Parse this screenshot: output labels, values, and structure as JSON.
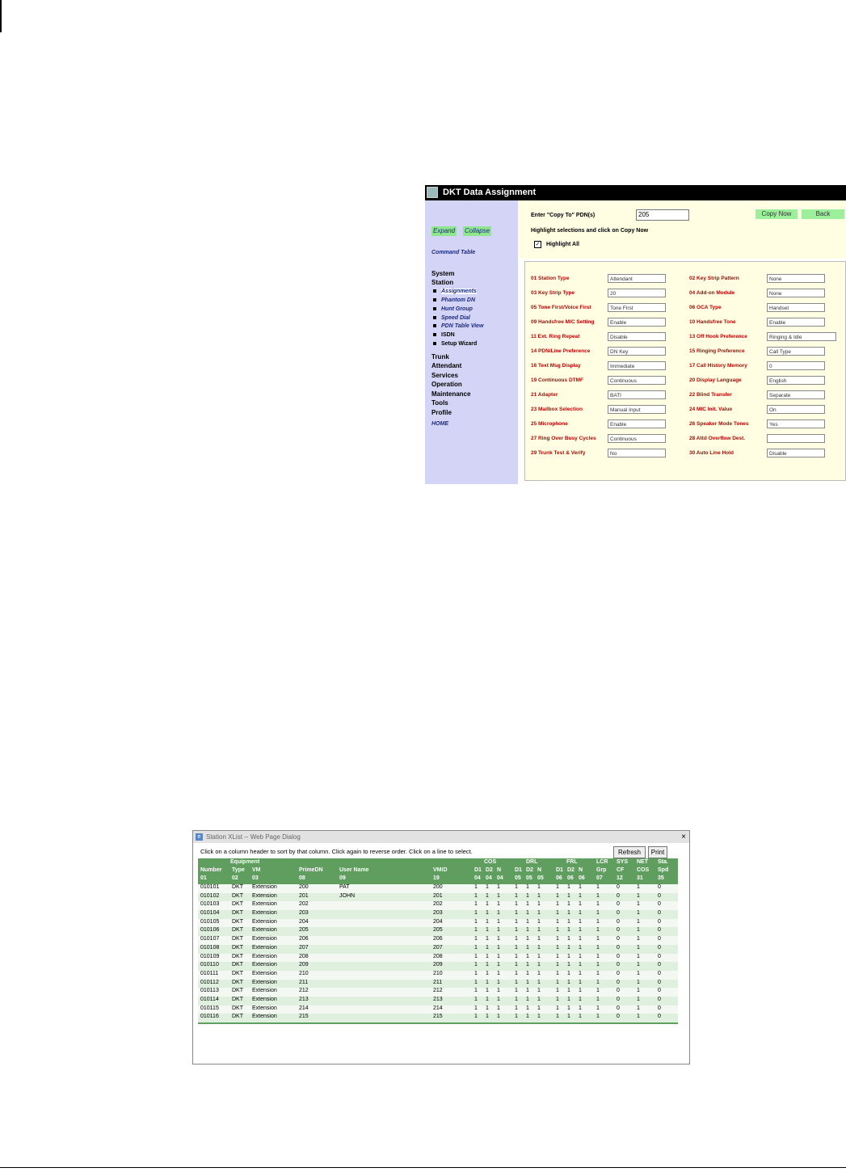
{
  "dkt": {
    "title": "DKT Data Assignment",
    "sidebar": {
      "expand": "Expand",
      "collapse": "Collapse",
      "command_table": "Command Table",
      "categories": [
        "System",
        "Station",
        "Trunk",
        "Attendant",
        "Services",
        "Operation",
        "Maintenance",
        "Tools",
        "Profile"
      ],
      "station_items": [
        "Assignments",
        "Phantom DN",
        "Hunt Group",
        "Speed Dial",
        "PDN Table View",
        "ISDN",
        "Setup Wizard"
      ],
      "home": "HOME"
    },
    "copy_to_label": "Enter \"Copy To\" PDN(s)",
    "copy_to_value": "205",
    "copy_now": "Copy Now",
    "back": "Back",
    "instruction": "Highlight selections and click on Copy Now",
    "highlight_all": "Highlight All",
    "highlight_checked": true,
    "fields": [
      {
        "label": "01 Station Type",
        "value": "Attendant"
      },
      {
        "label": "02 Key Strip Pattern",
        "value": "None"
      },
      {
        "label": "03 Key Strip Type",
        "value": "20"
      },
      {
        "label": "04 Add-on Module",
        "value": "None"
      },
      {
        "label": "05 Tone First/Voice First",
        "value": "Tone First"
      },
      {
        "label": "06 OCA Type",
        "value": "Handset"
      },
      {
        "label": "09 Handsfree MIC Setting",
        "value": "Enable"
      },
      {
        "label": "10 Handsfree Tone",
        "value": "Enable"
      },
      {
        "label": "11 Ext. Ring Repeat",
        "value": "Disable"
      },
      {
        "label": "13 Off Hook Preference",
        "value": "Ringing & Idle"
      },
      {
        "label": "14 PDN/Line Preference",
        "value": "DN Key"
      },
      {
        "label": "15 Ringing Preference",
        "value": "Call Type"
      },
      {
        "label": "16 Text Msg Display",
        "value": "Immediate"
      },
      {
        "label": "17 Call History Memory",
        "value": "0"
      },
      {
        "label": "19 Continuous DTMF",
        "value": "Continuous"
      },
      {
        "label": "20 Display Language",
        "value": "English"
      },
      {
        "label": "21 Adapter",
        "value": "BATI"
      },
      {
        "label": "22 Blind Transfer",
        "value": "Separate"
      },
      {
        "label": "23 Mailbox Selection",
        "value": "Manual Input"
      },
      {
        "label": "24 MIC Init. Value",
        "value": "On"
      },
      {
        "label": "25 Microphone",
        "value": "Enable"
      },
      {
        "label": "26 Speaker Mode Tones",
        "value": "Yes"
      },
      {
        "label": "27 Ring Over Busy Cycles",
        "value": "Continuous"
      },
      {
        "label": "28 Attd Overflow Dest.",
        "value": ""
      },
      {
        "label": "29 Trunk Test & Verify",
        "value": "No"
      },
      {
        "label": "30 Auto Line Hold",
        "value": "Disable"
      }
    ]
  },
  "xlist": {
    "title": "Station XList -- Web Page Dialog",
    "close": "×",
    "instruction": "Click on a column header to sort by that column. Click again to reverse order. Click on a line to select.",
    "refresh": "Refresh",
    "print": "Print",
    "header_groups": [
      "Equipment",
      "COS",
      "DRL",
      "FRL",
      "LCR",
      "SYS",
      "NET",
      "Sta."
    ],
    "header_names": [
      "Number",
      "Type",
      "VM",
      "PrimeDN",
      "User Name",
      "VMID",
      "D1",
      "D2",
      "N",
      "D1",
      "D2",
      "N",
      "D1",
      "D2",
      "N",
      "Grp",
      "CF",
      "COS",
      "Spd"
    ],
    "header_codes": [
      "01",
      "02",
      "03",
      "08",
      "09",
      "19",
      "04",
      "04",
      "04",
      "05",
      "05",
      "05",
      "06",
      "06",
      "06",
      "07",
      "12",
      "31",
      "35"
    ],
    "rows": [
      [
        "010101",
        "DKT",
        "Extension",
        "200",
        "PAT",
        "200",
        "1",
        "1",
        "1",
        "1",
        "1",
        "1",
        "1",
        "1",
        "1",
        "1",
        "0",
        "1",
        "0"
      ],
      [
        "010102",
        "DKT",
        "Extension",
        "201",
        "JOHN",
        "201",
        "1",
        "1",
        "1",
        "1",
        "1",
        "1",
        "1",
        "1",
        "1",
        "1",
        "0",
        "1",
        "0"
      ],
      [
        "010103",
        "DKT",
        "Extension",
        "202",
        "",
        "202",
        "1",
        "1",
        "1",
        "1",
        "1",
        "1",
        "1",
        "1",
        "1",
        "1",
        "0",
        "1",
        "0"
      ],
      [
        "010104",
        "DKT",
        "Extension",
        "203",
        "",
        "203",
        "1",
        "1",
        "1",
        "1",
        "1",
        "1",
        "1",
        "1",
        "1",
        "1",
        "0",
        "1",
        "0"
      ],
      [
        "010105",
        "DKT",
        "Extension",
        "204",
        "",
        "204",
        "1",
        "1",
        "1",
        "1",
        "1",
        "1",
        "1",
        "1",
        "1",
        "1",
        "0",
        "1",
        "0"
      ],
      [
        "010106",
        "DKT",
        "Extension",
        "205",
        "",
        "205",
        "1",
        "1",
        "1",
        "1",
        "1",
        "1",
        "1",
        "1",
        "1",
        "1",
        "0",
        "1",
        "0"
      ],
      [
        "010107",
        "DKT",
        "Extension",
        "206",
        "",
        "206",
        "1",
        "1",
        "1",
        "1",
        "1",
        "1",
        "1",
        "1",
        "1",
        "1",
        "0",
        "1",
        "0"
      ],
      [
        "010108",
        "DKT",
        "Extension",
        "207",
        "",
        "207",
        "1",
        "1",
        "1",
        "1",
        "1",
        "1",
        "1",
        "1",
        "1",
        "1",
        "0",
        "1",
        "0"
      ],
      [
        "010109",
        "DKT",
        "Extension",
        "208",
        "",
        "208",
        "1",
        "1",
        "1",
        "1",
        "1",
        "1",
        "1",
        "1",
        "1",
        "1",
        "0",
        "1",
        "0"
      ],
      [
        "010110",
        "DKT",
        "Extension",
        "209",
        "",
        "209",
        "1",
        "1",
        "1",
        "1",
        "1",
        "1",
        "1",
        "1",
        "1",
        "1",
        "0",
        "1",
        "0"
      ],
      [
        "010111",
        "DKT",
        "Extension",
        "210",
        "",
        "210",
        "1",
        "1",
        "1",
        "1",
        "1",
        "1",
        "1",
        "1",
        "1",
        "1",
        "0",
        "1",
        "0"
      ],
      [
        "010112",
        "DKT",
        "Extension",
        "211",
        "",
        "211",
        "1",
        "1",
        "1",
        "1",
        "1",
        "1",
        "1",
        "1",
        "1",
        "1",
        "0",
        "1",
        "0"
      ],
      [
        "010113",
        "DKT",
        "Extension",
        "212",
        "",
        "212",
        "1",
        "1",
        "1",
        "1",
        "1",
        "1",
        "1",
        "1",
        "1",
        "1",
        "0",
        "1",
        "0"
      ],
      [
        "010114",
        "DKT",
        "Extension",
        "213",
        "",
        "213",
        "1",
        "1",
        "1",
        "1",
        "1",
        "1",
        "1",
        "1",
        "1",
        "1",
        "0",
        "1",
        "0"
      ],
      [
        "010115",
        "DKT",
        "Extension",
        "214",
        "",
        "214",
        "1",
        "1",
        "1",
        "1",
        "1",
        "1",
        "1",
        "1",
        "1",
        "1",
        "0",
        "1",
        "0"
      ],
      [
        "010116",
        "DKT",
        "Extension",
        "215",
        "",
        "215",
        "1",
        "1",
        "1",
        "1",
        "1",
        "1",
        "1",
        "1",
        "1",
        "1",
        "0",
        "1",
        "0"
      ]
    ]
  }
}
